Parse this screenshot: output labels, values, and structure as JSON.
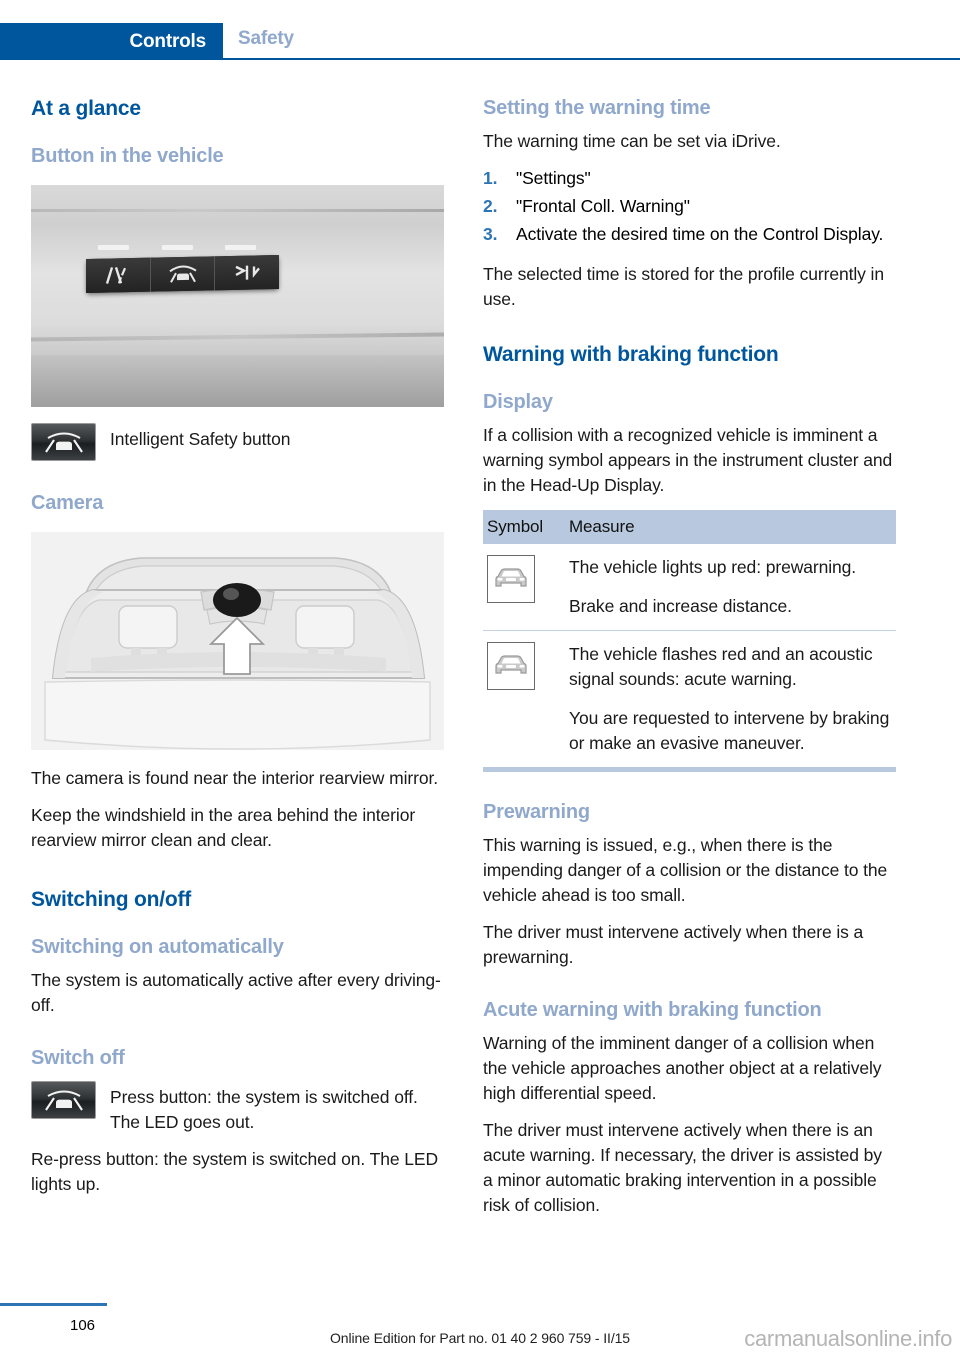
{
  "header": {
    "active_tab": "Controls",
    "inactive_tab": "Safety",
    "accent_color": "#00569d",
    "muted_color": "#8fa8cc"
  },
  "left_column": {
    "h_at_a_glance": "At a glance",
    "h_button_in_vehicle": "Button in the vehicle",
    "photo_buttons_alt": "dashboard-buttons-photo",
    "intelligent_safety_label": "Intelligent Safety button",
    "h_camera": "Camera",
    "photo_camera_alt": "windshield-camera-photo",
    "camera_p1": "The camera is found near the interior rearview mirror.",
    "camera_p2": "Keep the windshield in the area behind the interior rearview mirror clean and clear.",
    "h_switching_onoff": "Switching on/off",
    "h_switching_on_auto": "Switching on automatically",
    "switch_auto_p1": "The system is automatically active after every driving-off.",
    "h_switch_off": "Switch off",
    "switch_off_icon_text": "Press button: the system is switched off. The LED goes out.",
    "switch_off_p1": "Re-press button: the system is switched on. The LED lights up."
  },
  "right_column": {
    "h_setting_warning_time": "Setting the warning time",
    "warning_time_intro": "The warning time can be set via iDrive.",
    "steps": [
      {
        "num": "1.",
        "text": "\"Settings\""
      },
      {
        "num": "2.",
        "text": "\"Frontal Coll. Warning\""
      },
      {
        "num": "3.",
        "text": "Activate the desired time on the Control Display."
      }
    ],
    "warning_time_outro": "The selected time is stored for the profile currently in use.",
    "h_warning_with_braking": "Warning with braking function",
    "h_display": "Display",
    "display_p1": "If a collision with a recognized vehicle is imminent a warning symbol appears in the instrument cluster and in the Head-Up Display.",
    "table": {
      "columns": [
        "Symbol",
        "Measure"
      ],
      "rows": [
        {
          "symbol": "car-front-icon",
          "paragraphs": [
            "The vehicle lights up red: prewarning.",
            "Brake and increase distance."
          ]
        },
        {
          "symbol": "car-front-icon",
          "paragraphs": [
            "The vehicle flashes red and an acoustic signal sounds: acute warning.",
            "You are requested to intervene by braking or make an evasive maneuver."
          ]
        }
      ]
    },
    "h_prewarning": "Prewarning",
    "prewarning_p1": "This warning is issued, e.g., when there is the impending danger of a collision or the distance to the vehicle ahead is too small.",
    "prewarning_p2": "The driver must intervene actively when there is a prewarning.",
    "h_acute_warning": "Acute warning with braking function",
    "acute_p1": "Warning of the imminent danger of a collision when the vehicle approaches another object at a relatively high differential speed.",
    "acute_p2": "The driver must intervene actively when there is an acute warning. If necessary, the driver is assisted by a minor automatic braking intervention in a possible risk of collision."
  },
  "footer": {
    "page_number": "106",
    "edition_line": "Online Edition for Part no. 01 40 2 960 759 - II/15",
    "watermark": "carmanualsonline.info"
  }
}
